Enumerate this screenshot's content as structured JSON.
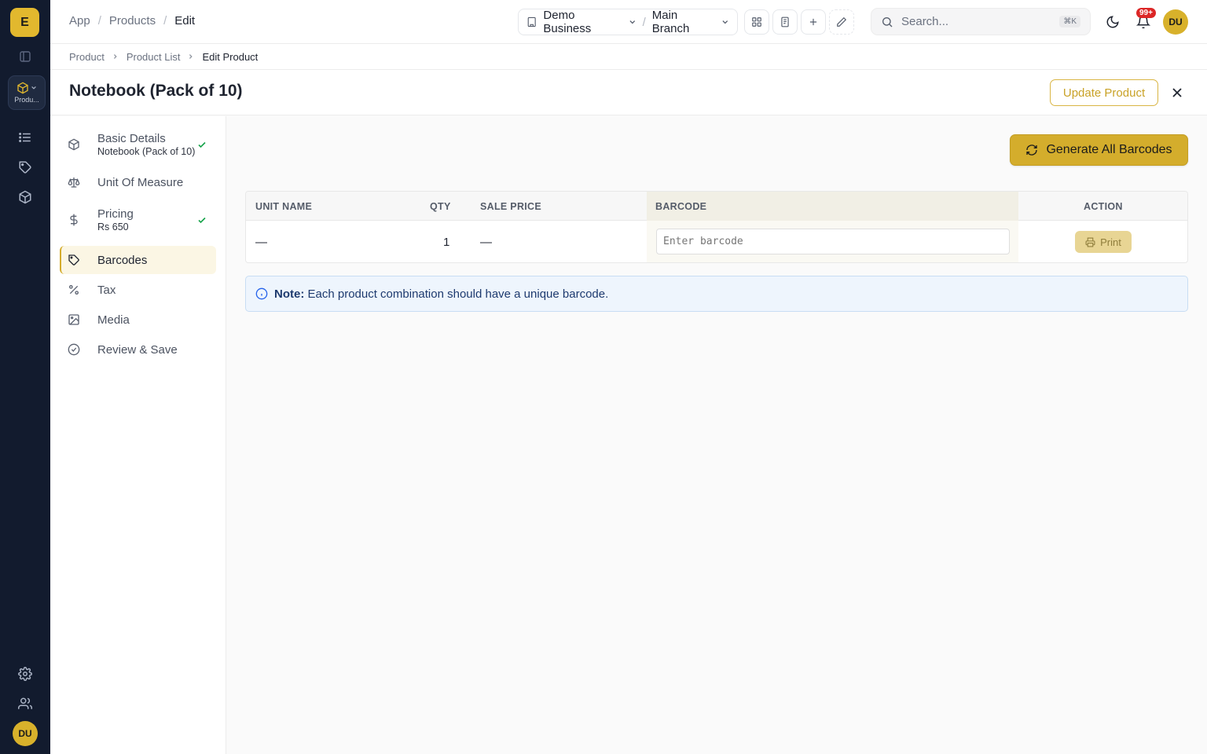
{
  "rail": {
    "logo_letter": "E",
    "module_label": "Produ...",
    "avatar_initials": "DU"
  },
  "topbar": {
    "breadcrumbs": [
      "App",
      "Products",
      "Edit"
    ],
    "business": "Demo Business",
    "branch": "Main Branch",
    "search_placeholder": "Search...",
    "search_shortcut": "⌘K",
    "notification_count": "99+",
    "avatar_initials": "DU"
  },
  "subcrumb": [
    "Product",
    "Product List",
    "Edit Product"
  ],
  "page": {
    "title": "Notebook (Pack of 10)",
    "update_label": "Update Product"
  },
  "steps": [
    {
      "label": "Basic Details",
      "sub": "Notebook (Pack of 10)",
      "icon": "box-icon",
      "done": true
    },
    {
      "label": "Unit Of Measure",
      "sub": "",
      "icon": "scale-icon",
      "done": false
    },
    {
      "label": "Pricing",
      "sub": "Rs 650",
      "icon": "dollar-icon",
      "done": true
    },
    {
      "label": "Barcodes",
      "sub": "",
      "icon": "tag-icon",
      "done": false,
      "active": true
    },
    {
      "label": "Tax",
      "sub": "",
      "icon": "percent-icon",
      "done": false
    },
    {
      "label": "Media",
      "sub": "",
      "icon": "image-icon",
      "done": false
    },
    {
      "label": "Review & Save",
      "sub": "",
      "icon": "check-circle-icon",
      "done": false
    }
  ],
  "main": {
    "generate_label": "Generate All Barcodes",
    "table": {
      "headers": {
        "unit_name": "UNIT NAME",
        "qty": "QTY",
        "sale_price": "SALE PRICE",
        "barcode": "BARCODE",
        "action": "ACTION"
      },
      "rows": [
        {
          "unit_name": "—",
          "qty": "1",
          "sale_price": "—",
          "barcode_value": "",
          "barcode_placeholder": "Enter barcode",
          "action_label": "Print"
        }
      ]
    },
    "note": {
      "label": "Note:",
      "text": "Each product combination should have a unique barcode."
    }
  },
  "colors": {
    "accent": "#d4ad2c",
    "rail_bg": "#121b2e",
    "success": "#16a34a",
    "note_bg": "#eef5fd"
  }
}
